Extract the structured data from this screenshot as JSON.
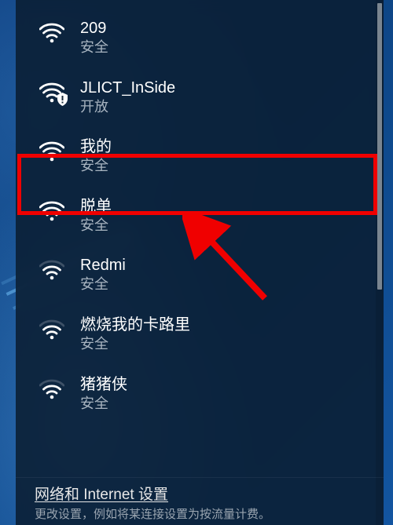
{
  "networks": [
    {
      "name": "209",
      "status": "安全",
      "signal": 4,
      "shield": false
    },
    {
      "name": "JLICT_InSide",
      "status": "开放",
      "signal": 4,
      "shield": true
    },
    {
      "name": "我的",
      "status": "安全",
      "signal": 4,
      "shield": false
    },
    {
      "name": "脱单",
      "status": "安全",
      "signal": 4,
      "shield": false
    },
    {
      "name": "Redmi",
      "status": "安全",
      "signal": 3,
      "shield": false
    },
    {
      "name": "燃烧我的卡路里",
      "status": "安全",
      "signal": 3,
      "shield": false
    },
    {
      "name": "猪猪侠",
      "status": "安全",
      "signal": 3,
      "shield": false
    }
  ],
  "footer": {
    "settings_link": "网络和 Internet 设置",
    "settings_sub": "更改设置，例如将某连接设置为按流量计费。"
  },
  "highlighted_index": 2,
  "colors": {
    "highlight": "#f00000",
    "arrow": "#f00000"
  }
}
